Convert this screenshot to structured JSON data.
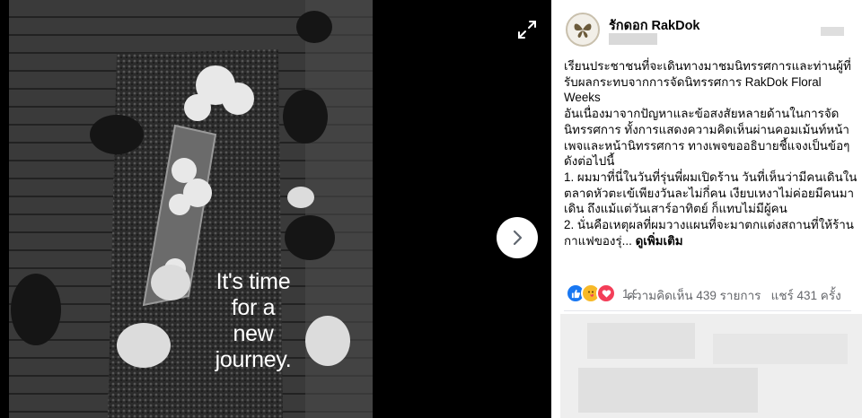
{
  "post": {
    "page_name": "รักดอก RakDok",
    "caption_paragraphs": [
      "เรียนประชาชนที่จะเดินทางมาชมนิทรรศการและท่านผู้ที่รับผลกระทบจากการจัดนิทรรศการ RakDok Floral Weeks",
      "อันเนื่องมาจากปัญหาและข้อสงสัยหลายด้านในการจัดนิทรรศการ ทั้งการแสดงความคิดเห็นผ่านคอมเม้นท์หน้าเพจและหน้านิทรรศการ ทางเพจขออธิบายชี้แจงเป็นข้อๆดังต่อไปนี้",
      "1. ผมมาที่นี่ในวันที่รุ่นพี่ผมเปิดร้าน วันที่เห็นว่ามีคนเดินในตลาดหัวตะเข้เพียงวันละไม่กี่คน เงียบเหงาไม่ค่อยมีคนมาเดิน ถึงแม้แต่วันเสาร์อาทิตย์ ก็แทบไม่มีผู้คน"
    ],
    "caption_last": "2. นั่นคือเหตุผลที่ผมวางแผนที่จะมาตกแต่งสถานที่ให้ร้านกาแฟของรุ่...",
    "see_more": "ดูเพิ่มเติม",
    "reaction_count": "1.9",
    "comments": "ความคิดเห็น 439 รายการ",
    "shares": "แชร์ 431 ครั้ง"
  },
  "photo": {
    "overlay_lines": [
      "It's time",
      "for a",
      "new",
      "journey."
    ]
  },
  "icons": {
    "expand": "expand-icon",
    "next": "chevron-right-icon",
    "like": "like-reaction-icon",
    "care": "care-reaction-icon",
    "love": "love-reaction-icon"
  },
  "colors": {
    "like": "#1877f2",
    "love": "#f33e58",
    "care": "#f7b928",
    "muted_text": "#65676b"
  }
}
